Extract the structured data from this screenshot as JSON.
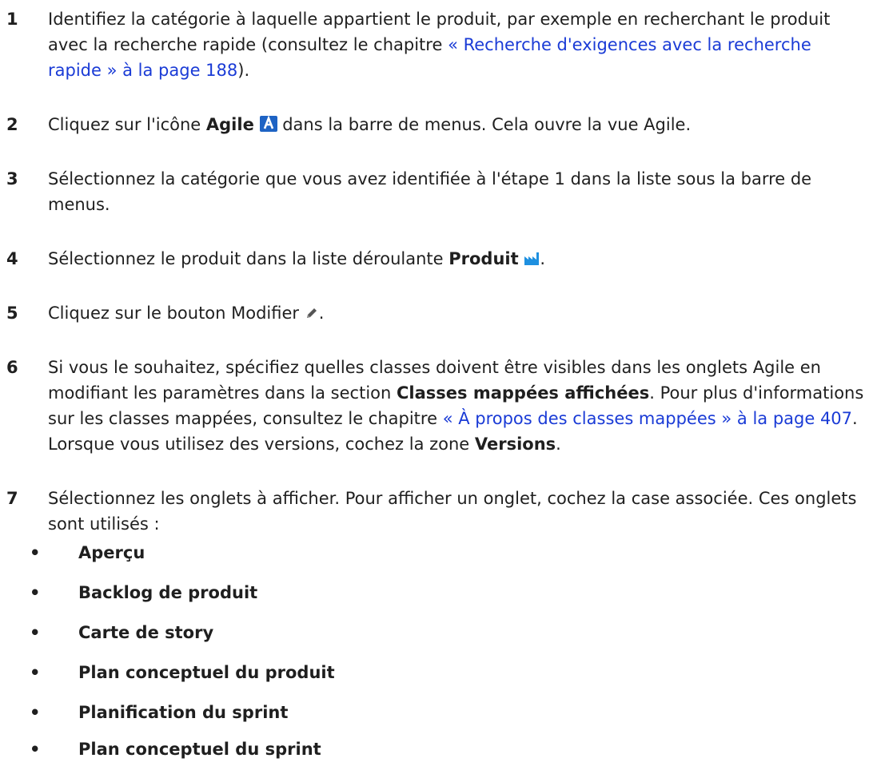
{
  "steps": [
    {
      "num": "1",
      "t1": "Identifiez la catégorie à laquelle appartient le produit, par exemple en recherchant le produit avec la recherche rapide (consultez le chapitre ",
      "link": "« Recherche d'exigences avec la recherche rapide » à la page 188",
      "t2": ")."
    },
    {
      "num": "2",
      "t1": "Cliquez sur l'icône ",
      "bold": "Agile",
      "t2": " dans la barre de menus. Cela ouvre la vue Agile."
    },
    {
      "num": "3",
      "t1": "Sélectionnez la catégorie que vous avez identifiée à l'étape 1 dans la liste sous la barre de menus."
    },
    {
      "num": "4",
      "t1": "Sélectionnez le produit dans la liste déroulante ",
      "bold": "Produit",
      "t2": "."
    },
    {
      "num": "5",
      "t1": "Cliquez sur le bouton Modifier ",
      "t2": "."
    },
    {
      "num": "6",
      "t1": "Si vous le souhaitez, spécifiez quelles classes doivent être visibles dans les onglets Agile en modifiant les paramètres dans la section ",
      "bold1": "Classes mappées affichées",
      "t2": ". Pour plus d'informations sur les classes mappées, consultez le chapitre ",
      "link": "« À propos des classes mappées » à la page 407",
      "t3": ". Lorsque vous utilisez des versions, cochez la zone ",
      "bold2": "Versions",
      "t4": "."
    },
    {
      "num": "7",
      "t1": "Sélectionnez les onglets à afficher. Pour afficher un onglet, cochez la case associée. Ces onglets sont utilisés :"
    }
  ],
  "bullets": [
    "Aperçu",
    "Backlog de produit",
    "Carte de story",
    "Plan conceptuel du produit",
    "Planification du sprint",
    "Plan conceptuel du sprint"
  ],
  "bullet_glyph": "•",
  "colors": {
    "link": "#1a3bd6",
    "agile_icon": "#1e63c4",
    "product_icon": "#1e90e0",
    "pencil_icon": "#555555"
  },
  "icons": {
    "agile": "agile-icon",
    "product": "product-factory-icon",
    "edit": "pencil-icon"
  }
}
